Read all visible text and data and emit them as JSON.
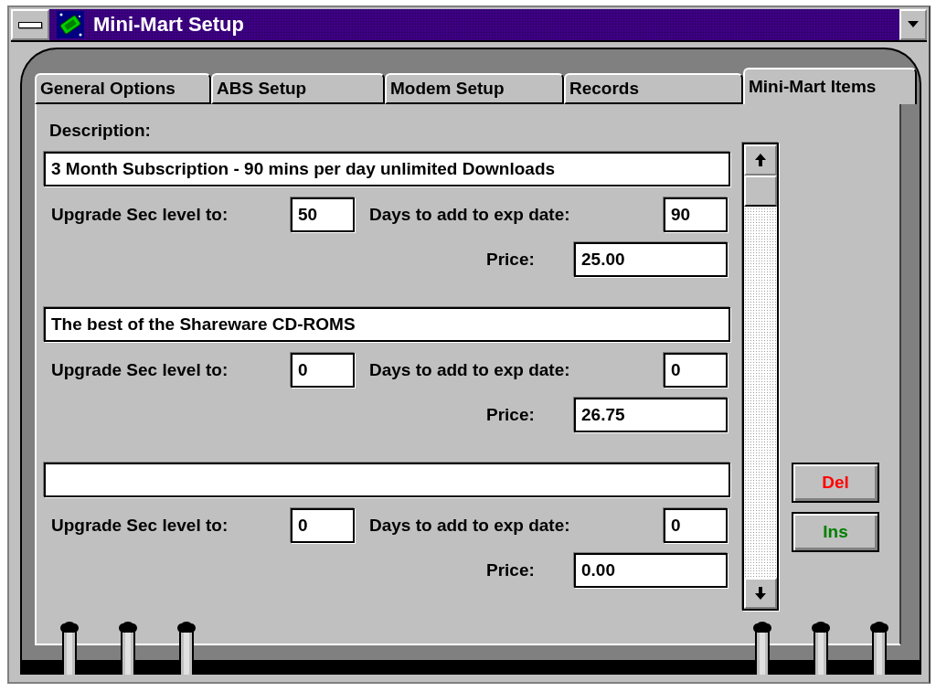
{
  "window": {
    "title": "Mini-Mart Setup"
  },
  "tabs": [
    {
      "label": "General Options",
      "selected": false
    },
    {
      "label": "ABS Setup",
      "selected": false
    },
    {
      "label": "Modem Setup",
      "selected": false
    },
    {
      "label": "Records",
      "selected": false
    },
    {
      "label": "Mini-Mart Items",
      "selected": true
    }
  ],
  "description_label": "Description:",
  "items": [
    {
      "description": "3 Month Subscription - 90 mins per day unlimited Downloads",
      "upgrade_label": "Upgrade Sec level to:",
      "upgrade_value": "50",
      "days_label": "Days to add to exp date:",
      "days_value": "90",
      "price_label": "Price:",
      "price_value": "25.00"
    },
    {
      "description": "The best of the Shareware CD-ROMS",
      "upgrade_label": "Upgrade Sec level to:",
      "upgrade_value": "0",
      "days_label": "Days to add to exp date:",
      "days_value": "0",
      "price_label": "Price:",
      "price_value": "26.75"
    },
    {
      "upgrade_label": "Upgrade Sec level to:",
      "upgrade_value": "0",
      "days_label": "Days to add to exp date:",
      "days_value": "0",
      "price_label": "Price:",
      "price_value": "0.00"
    }
  ],
  "buttons": [
    {
      "label": "Del",
      "color": "#ff0000"
    },
    {
      "label": "Ins",
      "color": "#008000"
    }
  ]
}
